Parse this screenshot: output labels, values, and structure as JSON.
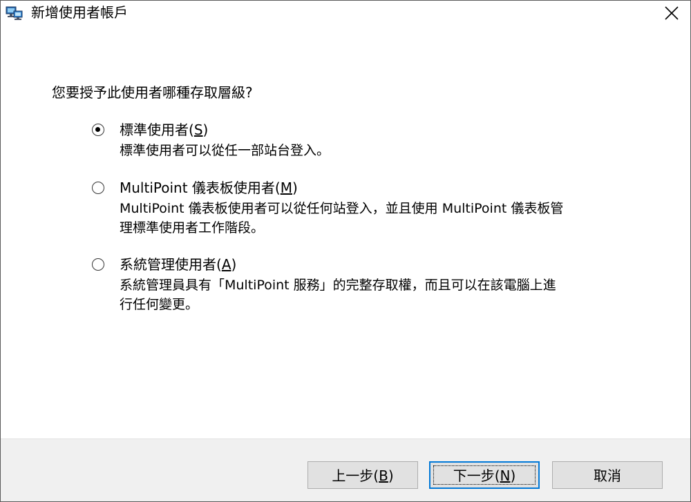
{
  "window": {
    "title": "新增使用者帳戶",
    "app_icon": "computer-network-icon",
    "close_icon": "close-icon"
  },
  "prompt": "您要授予此使用者哪種存取層級?",
  "options": [
    {
      "label_prefix": "標準使用者(",
      "hotkey": "S",
      "label_suffix": ")",
      "checked": true,
      "description_lines": [
        "標準使用者可以從任一部站台登入。"
      ]
    },
    {
      "label_prefix": "MultiPoint 儀表板使用者(",
      "hotkey": "M",
      "label_suffix": ")",
      "checked": false,
      "description_lines": [
        "MultiPoint 儀表板使用者可以從任何站登入，並且使用 MultiPoint 儀表板管",
        "理標準使用者工作階段。"
      ]
    },
    {
      "label_prefix": "系統管理使用者(",
      "hotkey": "A",
      "label_suffix": ")",
      "checked": false,
      "description_lines": [
        "系統管理員具有「MultiPoint 服務」的完整存取權，而且可以在該電腦上進",
        "行任何變更。"
      ]
    }
  ],
  "buttons": {
    "back": {
      "prefix": "上一步(",
      "hotkey": "B",
      "suffix": ")"
    },
    "next": {
      "prefix": "下一步(",
      "hotkey": "N",
      "suffix": ")"
    },
    "cancel": {
      "label": "取消"
    }
  },
  "colors": {
    "focus_border": "#0078d7",
    "footer_bg": "#f0f0f0",
    "button_bg": "#e1e1e1"
  }
}
